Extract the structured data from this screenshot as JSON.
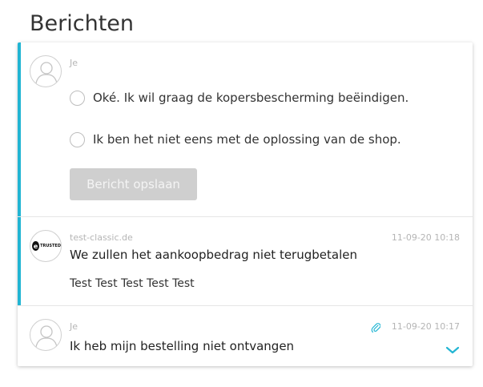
{
  "page": {
    "title": "Berichten"
  },
  "reply": {
    "sender": "Je",
    "options": [
      {
        "label": "Oké. Ik wil graag de kopersbescherming beëindigen."
      },
      {
        "label": "Ik ben het niet eens met de oplossing van de shop."
      }
    ],
    "save_label": "Bericht opslaan"
  },
  "messages": [
    {
      "sender": "test-classic.de",
      "timestamp": "11-09-20 10:18",
      "title": "We zullen het aankoopbedrag niet terugbetalen",
      "body": "Test Test Test Test Test",
      "logo_text": "TRUSTED"
    },
    {
      "sender": "Je",
      "timestamp": "11-09-20 10:17",
      "title": "Ik heb mijn bestelling niet ontvangen"
    }
  ],
  "colors": {
    "accent": "#22b5d3",
    "button_disabled": "#cfcfcf",
    "muted_text": "#b5b5b5"
  },
  "icons": {
    "attachment": "paperclip-icon",
    "expand": "chevron-down-icon",
    "avatar": "user-avatar-icon"
  }
}
